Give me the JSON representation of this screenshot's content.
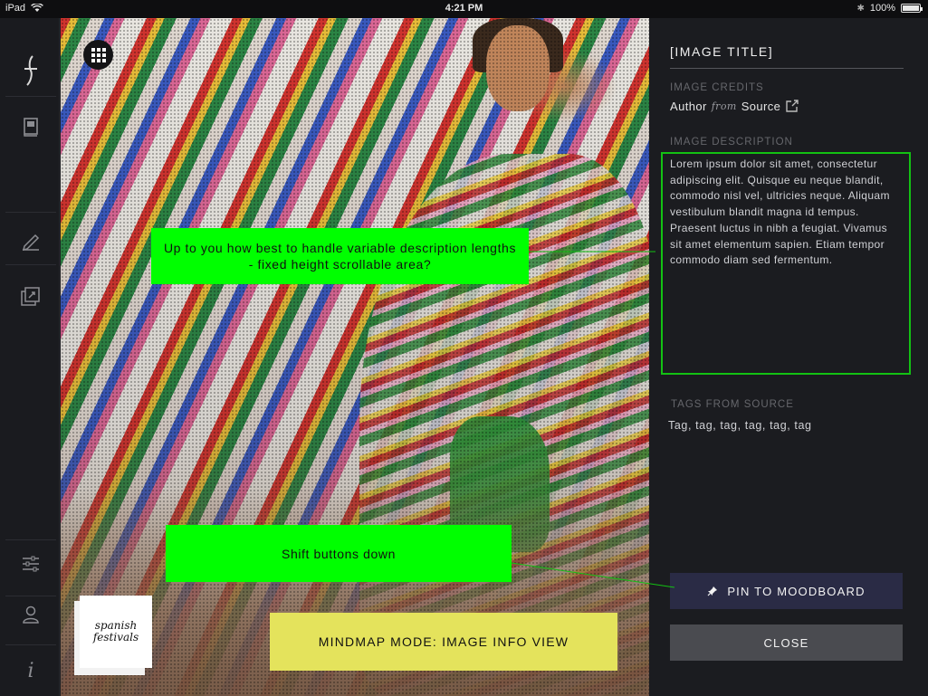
{
  "status_bar": {
    "device": "iPad",
    "time": "4:21 PM",
    "battery": "100%"
  },
  "sidebar": {
    "items": [
      {
        "icon": "logo-icon"
      },
      {
        "icon": "notebook-icon"
      },
      {
        "icon": "pen-icon"
      },
      {
        "icon": "pin-board-icon"
      },
      {
        "icon": "sliders-icon"
      },
      {
        "icon": "user-icon"
      },
      {
        "icon": "info-icon"
      }
    ]
  },
  "image": {
    "sticker_line1": "spanish",
    "sticker_line2": "festivals"
  },
  "annotations": {
    "description_note": "Up to you how best to handle variable description lengths - fixed height scrollable area?",
    "buttons_note": "Shift buttons down",
    "mode_label": "MINDMAP MODE: IMAGE INFO VIEW",
    "colors": {
      "note_green": "#00ff00",
      "mode_yellow": "#e4e35c",
      "outline_green": "#13c113"
    }
  },
  "info_panel": {
    "title": "[IMAGE TITLE]",
    "credits_label": "IMAGE CREDITS",
    "credits_author": "Author",
    "credits_from": "from",
    "credits_source": "Source",
    "description_label": "IMAGE DESCRIPTION",
    "description": "Lorem ipsum dolor sit amet, consectetur adipiscing elit. Quisque eu neque blandit, commodo nisl vel, ultricies neque. Aliquam vestibulum blandit magna id tempus. Praesent luctus in nibh a feugiat. Vivamus sit amet elementum sapien. Etiam tempor commodo diam sed fermentum.",
    "tags_label": "TAGS FROM SOURCE",
    "tags": "Tag, tag, tag, tag, tag, tag",
    "pin_button": "PIN TO MOODBOARD",
    "close_button": "CLOSE",
    "colors": {
      "pin_button": "#2a2b45",
      "close_button": "#4a4b50"
    }
  }
}
